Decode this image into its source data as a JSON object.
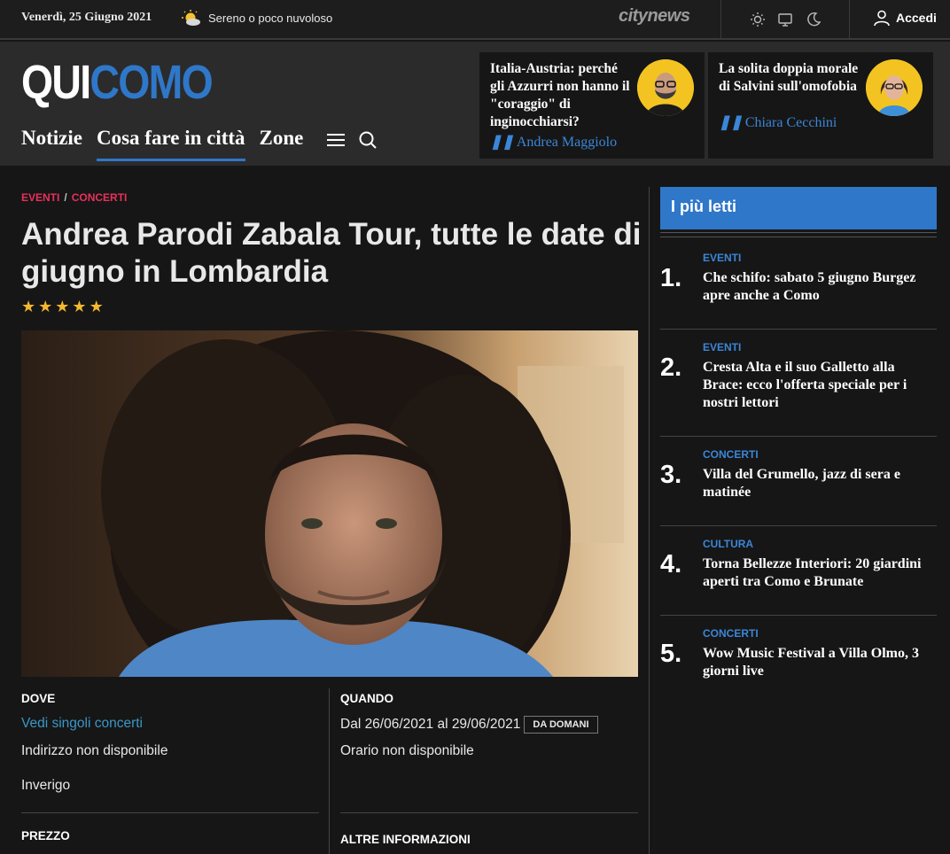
{
  "topbar": {
    "date": "Venerdì, 25 Giugno 2021",
    "weather_icon": "sun-cloud-icon",
    "weather": "Sereno o poco nuvoloso",
    "network_logo": "citynews",
    "login": "Accedi"
  },
  "header": {
    "logo_part1": "QUI",
    "logo_part2": "COMO",
    "nav": [
      "Notizie",
      "Cosa fare in città",
      "Zone"
    ],
    "promos": [
      {
        "title": "Italia-Austria: perché gli Azzurri non hanno il \"coraggio\" di inginocchiarsi?",
        "author": "Andrea Maggiolo"
      },
      {
        "title": "La solita doppia morale di Salvini sull'omofobia",
        "author": "Chiara Cecchini"
      }
    ]
  },
  "article": {
    "breadcrumb": [
      "EVENTI",
      "CONCERTI"
    ],
    "title": "Andrea Parodi Zabala Tour, tutte le date di giugno in Lombardia",
    "rating": 5,
    "dove_label": "DOVE",
    "dove_link": "Vedi singoli concerti",
    "address": "Indirizzo non disponibile",
    "place": "Inverigo",
    "quando_label": "QUANDO",
    "dates": "Dal 26/06/2021 al 29/06/2021",
    "badge": "DA DOMANI",
    "hours": "Orario non disponibile",
    "prezzo_label": "PREZZO",
    "altre_label": "ALTRE INFORMAZIONI"
  },
  "sidebar": {
    "title": "I più letti",
    "items": [
      {
        "num": "1.",
        "cat": "EVENTI",
        "title": "Che schifo: sabato 5 giugno Burgez apre anche a Como"
      },
      {
        "num": "2.",
        "cat": "EVENTI",
        "title": "Cresta Alta e il suo Galletto alla Brace: ecco l'offerta speciale per i nostri lettori"
      },
      {
        "num": "3.",
        "cat": "CONCERTI",
        "title": "Villa del Grumello, jazz di sera e matinée"
      },
      {
        "num": "4.",
        "cat": "CULTURA",
        "title": "Torna Bellezze Interiori: 20 giardini aperti tra Como e Brunate"
      },
      {
        "num": "5.",
        "cat": "CONCERTI",
        "title": "Wow Music Festival a Villa Olmo, 3 giorni live"
      }
    ]
  }
}
